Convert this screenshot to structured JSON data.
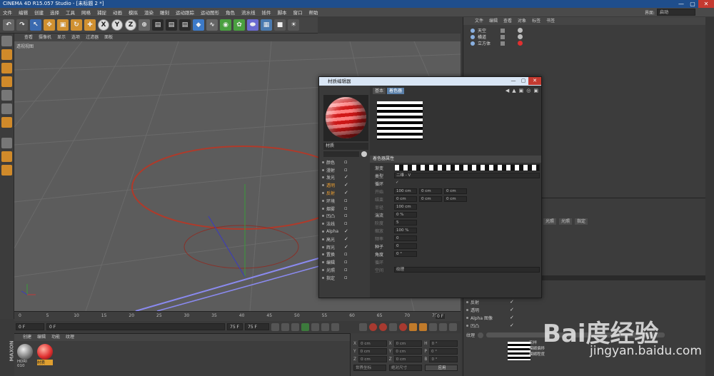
{
  "window": {
    "title": "CINEMA 4D R15.057 Studio - [未标题 2 *]",
    "min_label": "—",
    "max_label": "▢",
    "close_label": "✕"
  },
  "menubar": [
    "文件",
    "编辑",
    "创建",
    "选择",
    "工具",
    "网格",
    "捕捉",
    "动画",
    "模拟",
    "渲染",
    "雕刻",
    "运动跟踪",
    "运动图形",
    "角色",
    "流水线",
    "插件",
    "脚本",
    "窗口",
    "帮助"
  ],
  "layout": {
    "label": "界面:",
    "value": "启动"
  },
  "toolbar": {
    "undo_icon": "undo-icon",
    "axis_buttons": [
      "X",
      "Y",
      "Z"
    ]
  },
  "viewport": {
    "menu": [
      "查看",
      "摄像机",
      "显示",
      "选项",
      "过滤器",
      "面板"
    ],
    "label": "透视视图"
  },
  "timeline": {
    "ticks": [
      "0",
      "5",
      "10",
      "15",
      "20",
      "25",
      "30",
      "35",
      "40",
      "45",
      "50",
      "55",
      "60",
      "65",
      "70",
      "75"
    ],
    "end_label": "0 F"
  },
  "transport": {
    "start_field": "0 F",
    "current_field": "0 F",
    "end_field": "75 F",
    "max_field": "75 F"
  },
  "material_manager": {
    "menu": [
      "创建",
      "编辑",
      "功能",
      "纹理"
    ],
    "materials": [
      {
        "name": "HDRI 010"
      },
      {
        "name": "材质"
      }
    ]
  },
  "coordinates": {
    "rows": [
      {
        "axis": "X",
        "pos": "0 cm",
        "axis2": "X",
        "size": "0 cm",
        "rot_axis": "H",
        "rot": "0 °"
      },
      {
        "axis": "Y",
        "pos": "0 cm",
        "axis2": "Y",
        "size": "0 cm",
        "rot_axis": "P",
        "rot": "0 °"
      },
      {
        "axis": "Z",
        "pos": "0 cm",
        "axis2": "Z",
        "size": "0 cm",
        "rot_axis": "B",
        "rot": "0 °"
      }
    ],
    "mode1": "世界坐标",
    "mode2": "绝对尺寸",
    "apply_label": "应用"
  },
  "object_manager": {
    "menu": [
      "文件",
      "编辑",
      "查看",
      "对象",
      "标签",
      "书签"
    ],
    "objects": [
      {
        "name": "天空"
      },
      {
        "name": "横道"
      },
      {
        "name": "立方体"
      }
    ]
  },
  "attr_manager": {
    "tabs": [
      "光照",
      "光照",
      "指定"
    ],
    "rows": [
      {
        "label": "反射"
      },
      {
        "label": "透明"
      },
      {
        "label": "Alpha 图像"
      },
      {
        "label": "凹凸"
      }
    ],
    "texture_label": "纹理",
    "sampling_label": "采样",
    "blur_offset": "模糊偏移",
    "blur_scale": "模糊程度"
  },
  "material_editor": {
    "title": "材质编辑器",
    "material_name": "材质",
    "channels": [
      {
        "name": "颜色",
        "checked": false
      },
      {
        "name": "漫射",
        "checked": false
      },
      {
        "name": "发光",
        "checked": true
      },
      {
        "name": "透明",
        "checked": true,
        "active": true
      },
      {
        "name": "反射",
        "checked": true,
        "active": true
      },
      {
        "name": "环境",
        "checked": false
      },
      {
        "name": "烟雾",
        "checked": false
      },
      {
        "name": "凹凸",
        "checked": false
      },
      {
        "name": "法线",
        "checked": false
      },
      {
        "name": "Alpha",
        "checked": true
      },
      {
        "name": "高光",
        "checked": true
      },
      {
        "name": "辉光",
        "checked": true
      },
      {
        "name": "置换",
        "checked": false
      },
      {
        "name": "编辑",
        "checked": false
      },
      {
        "name": "光照",
        "checked": false
      },
      {
        "name": "指定",
        "checked": false
      }
    ],
    "tabs": [
      "基本",
      "着色器"
    ],
    "active_tab": "着色器",
    "section": "着色器属性",
    "props": [
      {
        "label": "渐变"
      },
      {
        "label": "类型",
        "value": "二维 - V"
      },
      {
        "label": "循环",
        "value": "✓"
      },
      {
        "label": "开始",
        "value": "100 cm"
      },
      {
        "label": "结束",
        "value": "0 cm"
      },
      {
        "label": "半径",
        "value": "100 cm"
      },
      {
        "label": "湍流",
        "value": "0 %"
      },
      {
        "label": "阶度",
        "value": "5"
      },
      {
        "label": "缩放",
        "value": "100 %"
      },
      {
        "label": "频率",
        "value": "0"
      },
      {
        "label": "种子",
        "value": "0"
      },
      {
        "label": "角度",
        "value": "0 °"
      },
      {
        "label": "循环"
      },
      {
        "label": "空间",
        "value": "纹理"
      }
    ]
  },
  "watermark": {
    "brand": "Bai度经验",
    "url": "jingyan.baidu.com"
  },
  "colors": {
    "accent": "#f0a030",
    "title_bar": "#1f4e8c",
    "tab_active": "#5a7fa8"
  }
}
